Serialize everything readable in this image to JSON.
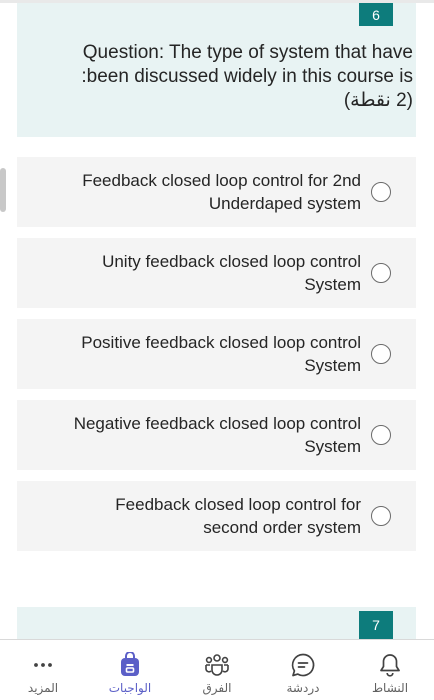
{
  "question": {
    "number": "6",
    "text": "Question: The type of system that have :been discussed widely in this course is",
    "points": "(2 نقطة)"
  },
  "options": [
    {
      "label": "Feedback closed loop control for 2nd Underdaped system",
      "selected": false
    },
    {
      "label": "Unity feedback closed loop control System",
      "selected": false
    },
    {
      "label": "Positive feedback closed loop control System",
      "selected": false
    },
    {
      "label": "Negative feedback closed loop control System",
      "selected": false
    },
    {
      "label": "Feedback closed loop control for second order system",
      "selected": false
    }
  ],
  "next_question": {
    "number": "7"
  },
  "nav": {
    "more": {
      "label": "المزيد",
      "icon": "more-dots-icon"
    },
    "assignments": {
      "label": "الواجبات",
      "icon": "assignments-bag-icon",
      "active": true
    },
    "teams": {
      "label": "الفرق",
      "icon": "teams-icon"
    },
    "chat": {
      "label": "دردشة",
      "icon": "chat-bubble-icon"
    },
    "activity": {
      "label": "النشاط",
      "icon": "bell-icon"
    }
  },
  "colors": {
    "accent": "#0d7c7c",
    "card_bg": "#e8f3f3",
    "option_bg": "#f4f4f4",
    "nav_active": "#5b5fc7"
  }
}
